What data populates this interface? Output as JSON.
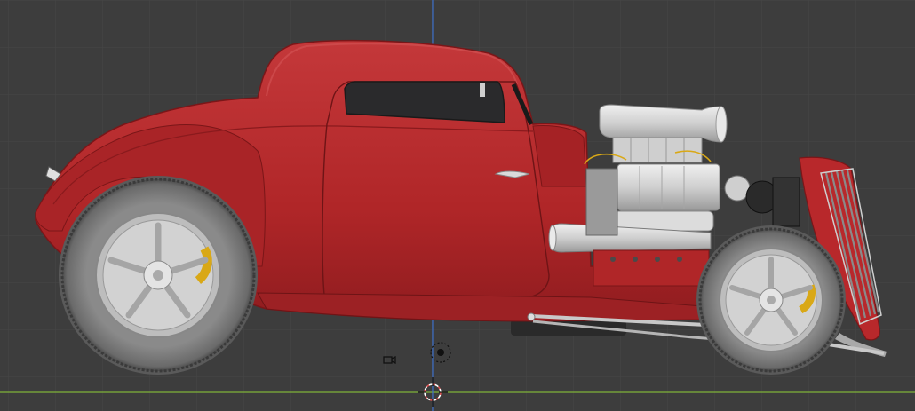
{
  "viewport": {
    "view": "side-orthographic",
    "background_color": "#3d3d3d",
    "grid_color": "#4a4a4a",
    "axis_x_color": "#7fb23a",
    "axis_z_color": "#3b6fc9"
  },
  "model": {
    "subject": "hot-rod-coupe",
    "body_color": "#b8282b",
    "tire_color": "#7a7a7a",
    "wheel_color": "#c9c9c9",
    "engine_color": "#d4d4d4",
    "caliper_color": "#d9a816"
  },
  "icons": {
    "camera": "camera-icon",
    "light": "light-icon",
    "cursor": "3d-cursor-icon"
  }
}
